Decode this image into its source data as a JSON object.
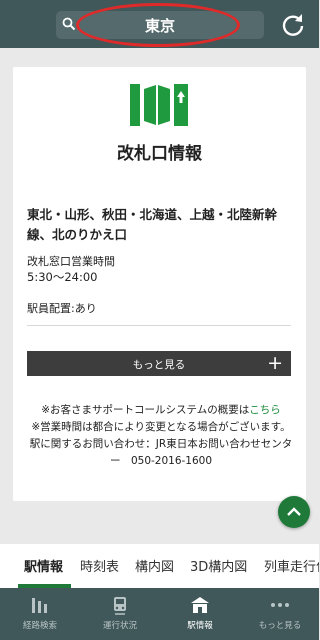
{
  "header": {
    "search_value": "東京",
    "icons": {
      "search": "search-icon",
      "refresh": "refresh-icon"
    },
    "highlight_color": "#e02a2a"
  },
  "card": {
    "icon": "ticket-gate-icon",
    "title": "改札口情報",
    "exit_name": "東北・山形、秋田・北海道、上越・北陸新幹線、北のりかえ口",
    "hours_label": "改札窓口営業時間",
    "hours_value": "5:30〜24:00",
    "staff": "駅員配置:あり",
    "more_label": "もっと見る",
    "notice": {
      "line1_prefix": "※お客さまサポートコールシステムの概要は",
      "line1_link": "こちら",
      "line2": "※営業時間は都合により変更となる場合がございます。",
      "line3": "駅に関するお問い合わせ：JR東日本お問い合わせセンター　050-2016-1600"
    }
  },
  "tabs": [
    "駅情報",
    "時刻表",
    "構内図",
    "3D構内図",
    "列車走行位置"
  ],
  "bottom_nav": [
    {
      "label": "経路検索",
      "icon": "route-search-icon"
    },
    {
      "label": "運行状況",
      "icon": "train-icon"
    },
    {
      "label": "駅情報",
      "icon": "station-icon"
    },
    {
      "label": "もっと見る",
      "icon": "more-dots-icon"
    }
  ],
  "colors": {
    "brand_green": "#1f7a3a",
    "header_bg": "#40585a"
  }
}
